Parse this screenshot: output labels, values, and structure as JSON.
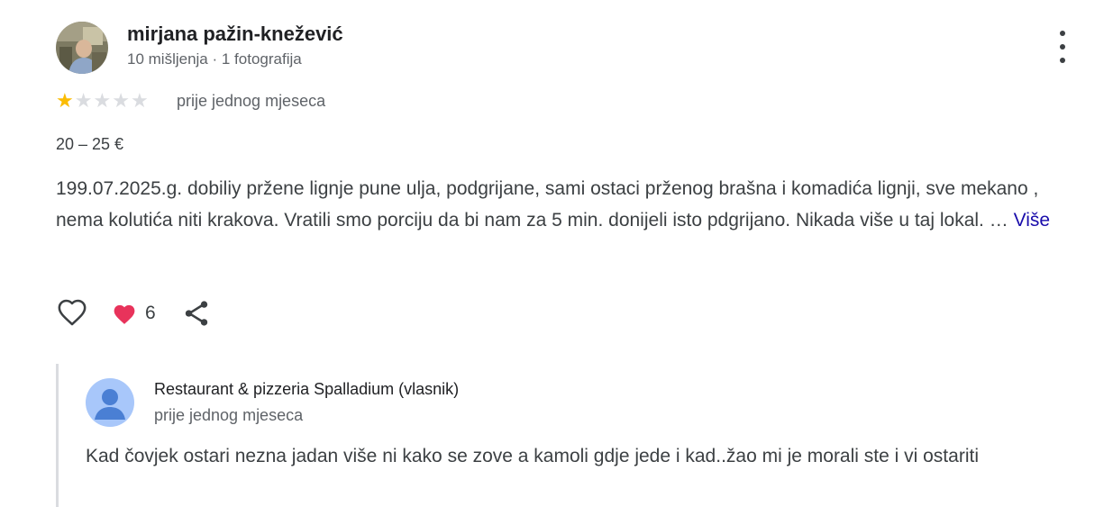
{
  "reviewer": {
    "name": "mirjana pažin-knežević",
    "meta": "10 mišljenja · 1 fotografija"
  },
  "review": {
    "rating": 1,
    "max_rating": 5,
    "date": "prije jednog mjeseca",
    "price": "20 – 25 €",
    "text": "199.07.2025.g. dobiliy pržene lignje pune ulja, podgrijane, sami ostaci prženog brašna i komadića lignji, sve mekano , nema kolutića niti krakova. Vratili smo porciju da bi nam za 5 min. donijeli isto pdgrijano. Nikada više u taj lokal. …",
    "more_label": "Više"
  },
  "actions": {
    "like_icon": "heart-outline-icon",
    "reaction_icon": "heart-filled-icon",
    "reaction_count": "6",
    "share_icon": "share-icon"
  },
  "owner_reply": {
    "name": "Restaurant & pizzeria Spalladium (vlasnik)",
    "date": "prije jednog mjeseca",
    "text": "Kad čovjek ostari nezna jadan više ni kako se zove a kamoli gdje jede i kad..žao mi je morali ste i vi ostariti"
  },
  "colors": {
    "star_on": "#fbbc04",
    "star_off": "#dadce0",
    "link": "#1a0dab",
    "reaction_heart": "#e8335b",
    "owner_avatar_bg": "#a8c7fa",
    "owner_avatar_fg": "#4a7fd4"
  }
}
